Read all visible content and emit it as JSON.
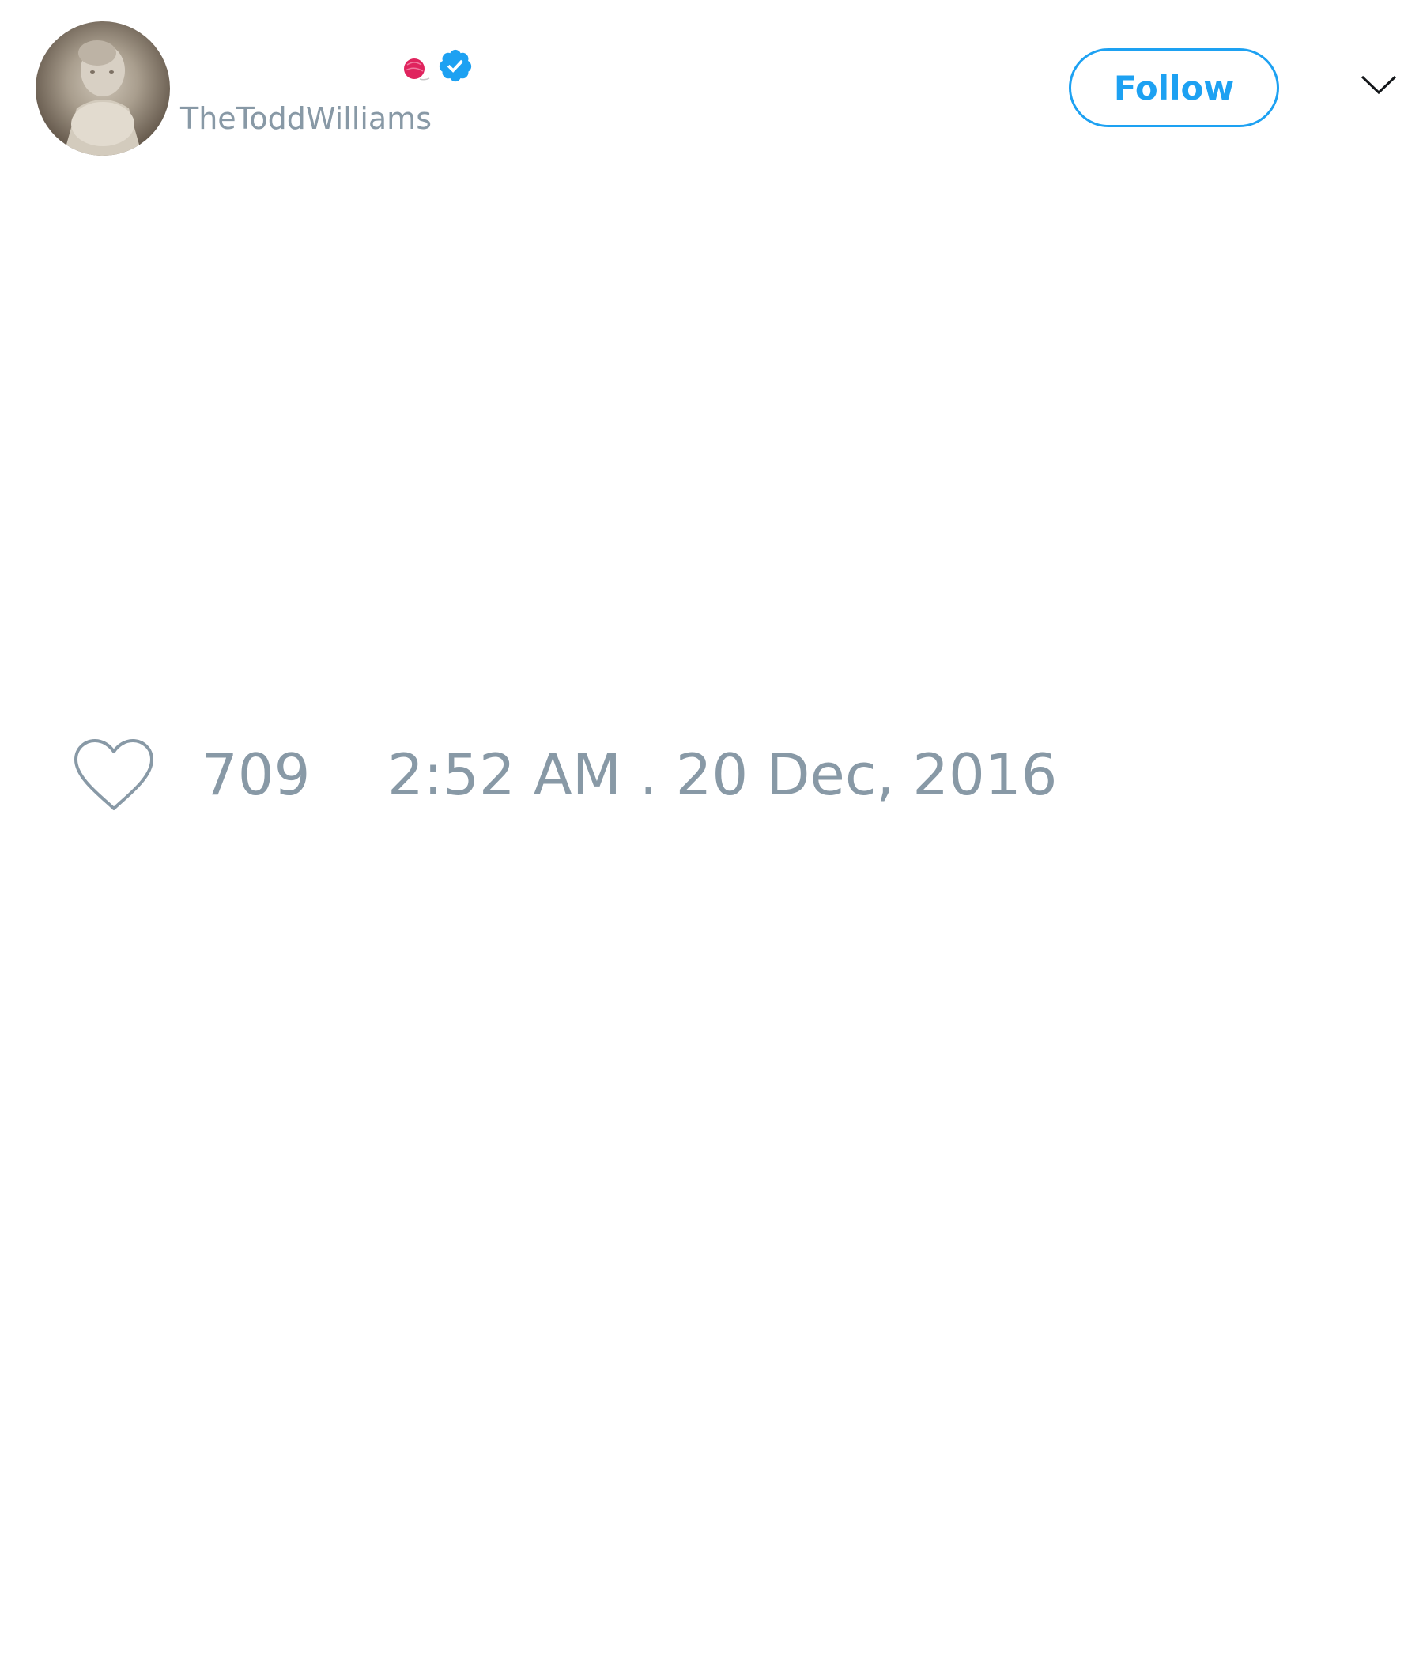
{
  "tweet": {
    "author": {
      "display_name": "",
      "handle": "TheToddWilliams",
      "avatar_icon": "statue-avatar",
      "name_emoji_icon": "yarn-ball-icon",
      "verified_icon": "verified-badge-icon",
      "verified": true
    },
    "follow_label": "Follow",
    "menu_icon": "chevron-down-icon",
    "body_text": "",
    "likes": {
      "icon": "heart-icon",
      "count": "709"
    },
    "timestamp": "2:52 AM . 20 Dec, 2016"
  },
  "colors": {
    "accent": "#1da1f2",
    "muted_text": "#8899a6",
    "background": "#ffffff",
    "emoji": "#e0245e"
  }
}
